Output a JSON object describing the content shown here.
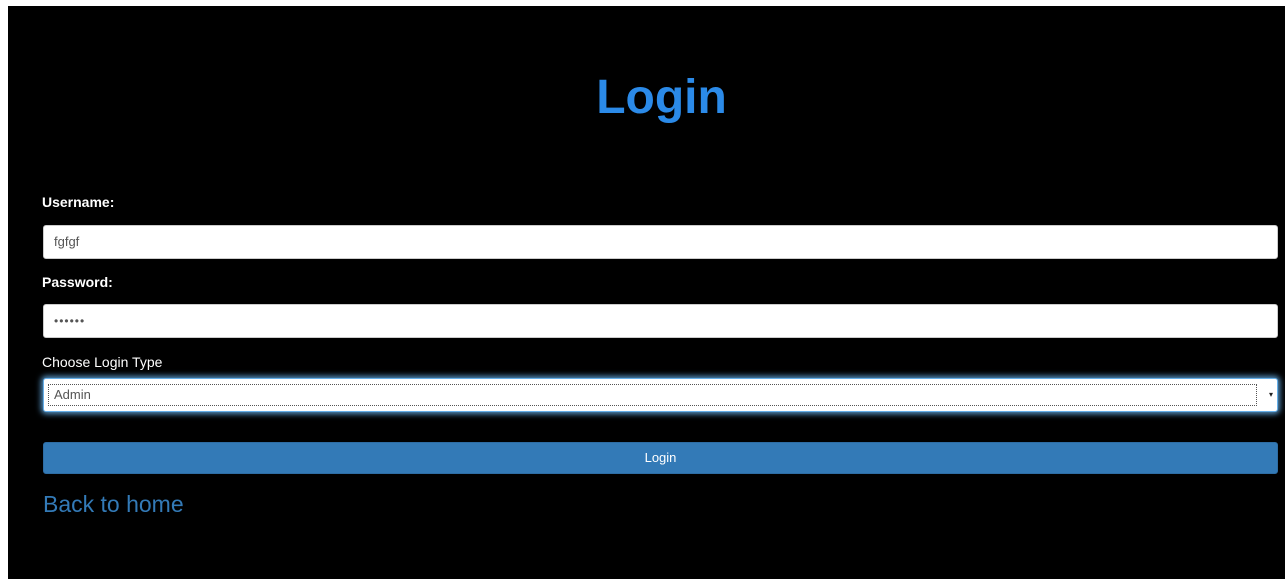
{
  "page": {
    "title": "Login"
  },
  "form": {
    "username_label": "Username:",
    "username_value": "fgfgf",
    "password_label": "Password:",
    "password_mask": "••••••",
    "login_type_label": "Choose Login Type",
    "login_type_selected": "Admin",
    "submit_label": "Login"
  },
  "links": {
    "back_home": "Back to home"
  },
  "colors": {
    "background": "#000000",
    "title": "#2b8ae8",
    "button": "#337ab7",
    "link": "#337ab7"
  }
}
